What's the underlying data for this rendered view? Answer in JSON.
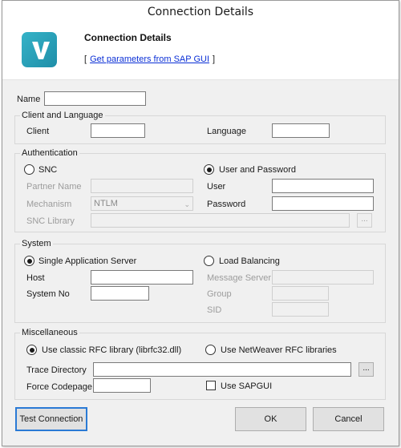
{
  "window": {
    "title": "Connection Details"
  },
  "header": {
    "title": "Connection Details",
    "link_open": "[",
    "link_text": "Get parameters from SAP GUI",
    "link_close": "]",
    "logo_icon": "v-logo-icon",
    "logo_color": "#2aa3bb"
  },
  "name": {
    "label": "Name",
    "value": ""
  },
  "client_language": {
    "title": "Client and Language",
    "client_label": "Client",
    "client_value": "",
    "language_label": "Language",
    "language_value": ""
  },
  "authentication": {
    "title": "Authentication",
    "snc_label": "SNC",
    "snc_selected": false,
    "partner_name_label": "Partner Name",
    "partner_name_value": "",
    "mechanism_label": "Mechanism",
    "mechanism_value": "NTLM",
    "snc_library_label": "SNC Library",
    "snc_library_value": "",
    "browse_label": "...",
    "user_password_label": "User and Password",
    "user_password_selected": true,
    "user_label": "User",
    "user_value": "",
    "password_label": "Password",
    "password_value": ""
  },
  "system": {
    "title": "System",
    "single_label": "Single Application Server",
    "single_selected": true,
    "host_label": "Host",
    "host_value": "",
    "system_no_label": "System No",
    "system_no_value": "",
    "load_balancing_label": "Load Balancing",
    "load_balancing_selected": false,
    "message_server_label": "Message Server",
    "message_server_value": "",
    "group_label": "Group",
    "group_value": "",
    "sid_label": "SID",
    "sid_value": ""
  },
  "misc": {
    "title": "Miscellaneous",
    "classic_label": "Use classic RFC library (librfc32.dll)",
    "classic_selected": true,
    "netweaver_label": "Use NetWeaver RFC libraries",
    "netweaver_selected": false,
    "trace_label": "Trace Directory",
    "trace_value": "",
    "browse_label": "...",
    "codepage_label": "Force Codepage",
    "codepage_value": "",
    "sapgui_label": "Use SAPGUI",
    "sapgui_checked": false
  },
  "buttons": {
    "test": "Test Connection",
    "ok": "OK",
    "cancel": "Cancel"
  }
}
